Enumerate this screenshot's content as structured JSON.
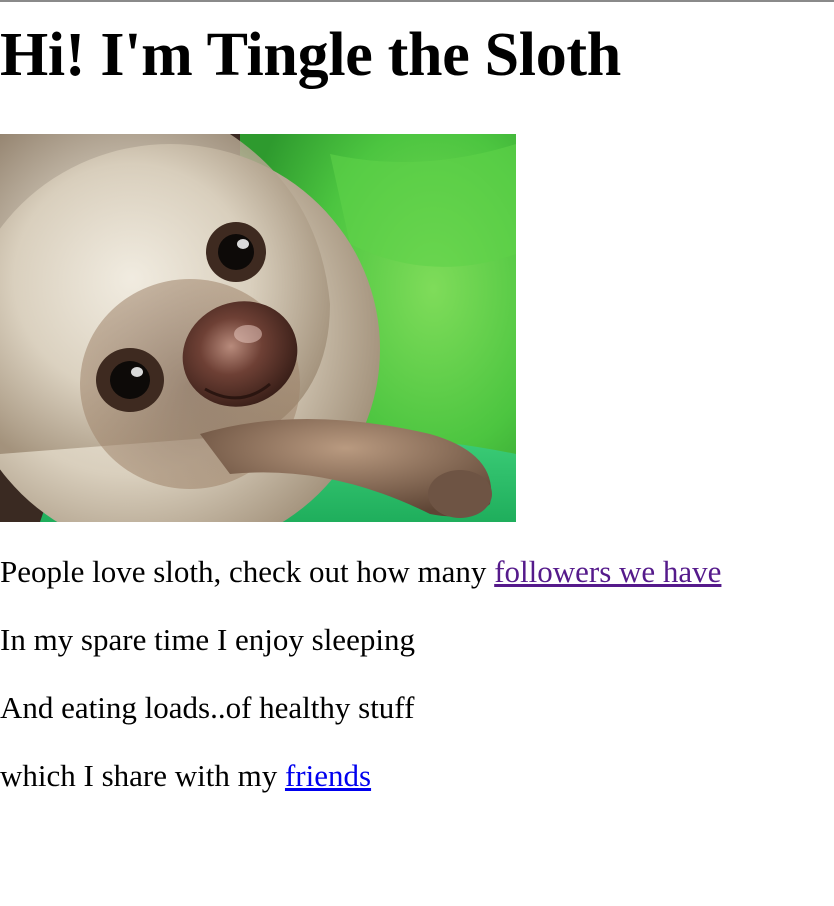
{
  "page": {
    "title": "Hi! I'm Tingle the Sloth"
  },
  "image": {
    "icon": "sloth-photo"
  },
  "paragraphs": {
    "p1_text": "People love sloth, check out how many ",
    "p1_link": "followers we have",
    "p2_text": "In my spare time I enjoy sleeping",
    "p3_text": "And eating loads..of healthy stuff",
    "p4_text": "which I share with my ",
    "p4_link": "friends"
  },
  "colors": {
    "visited_link": "#551a8b",
    "link": "#0000ee",
    "towel_green": "#4cc540"
  }
}
